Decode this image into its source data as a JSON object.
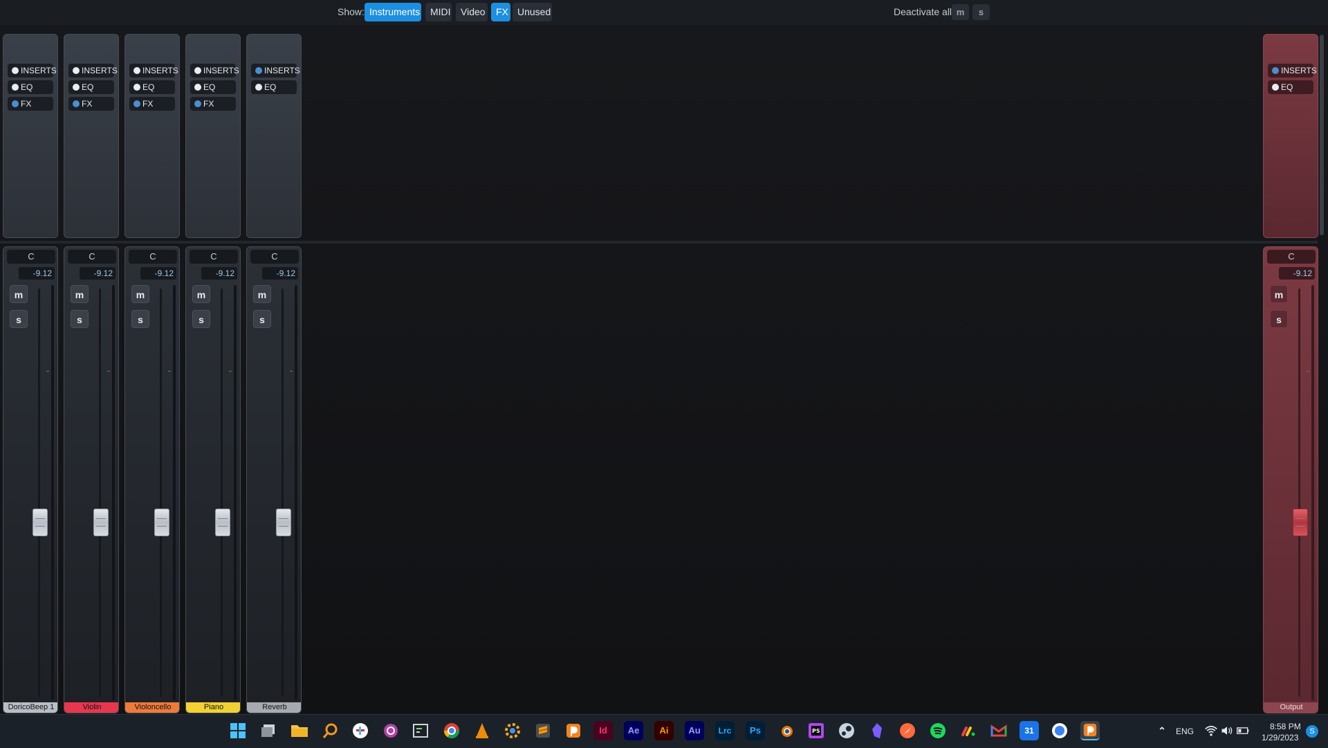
{
  "toolbar": {
    "show_label": "Show:",
    "filters": [
      {
        "label": "Instruments",
        "active": true
      },
      {
        "label": "MIDI",
        "active": false
      },
      {
        "label": "Video",
        "active": false
      },
      {
        "label": "FX",
        "active": true
      },
      {
        "label": "Unused",
        "active": false
      }
    ],
    "deactivate_label": "Deactivate all:",
    "deactivate_mute": "m",
    "deactivate_solo": "s"
  },
  "channels": [
    {
      "name": "DoricoBeep 1",
      "color": "#b9bec6",
      "pan": "C",
      "volume": "-9.12",
      "slots": [
        "INSERTS",
        "EQ",
        "FX"
      ],
      "mute": "m",
      "solo": "s"
    },
    {
      "name": "Violin",
      "color": "#e8364f",
      "pan": "C",
      "volume": "-9.12",
      "slots": [
        "INSERTS",
        "EQ",
        "FX"
      ],
      "mute": "m",
      "solo": "s"
    },
    {
      "name": "Violoncello",
      "color": "#f07a3a",
      "pan": "C",
      "volume": "-9.12",
      "slots": [
        "INSERTS",
        "EQ",
        "FX"
      ],
      "mute": "m",
      "solo": "s"
    },
    {
      "name": "Piano",
      "color": "#f2d233",
      "pan": "C",
      "volume": "-9.12",
      "slots": [
        "INSERTS",
        "EQ",
        "FX"
      ],
      "mute": "m",
      "solo": "s"
    },
    {
      "name": "Reverb",
      "color": "#a6abb2",
      "pan": "C",
      "volume": "-9.12",
      "slots": [
        "INSERTS",
        "EQ"
      ],
      "mute": "m",
      "solo": "s"
    },
    {
      "name": "Output",
      "color": "#8c4650",
      "pan": "C",
      "volume": "-9.12",
      "slots": [
        "INSERTS",
        "EQ"
      ],
      "mute": "m",
      "solo": "s"
    }
  ],
  "taskbar": {
    "apps": [
      {
        "icon": "windows-start-icon",
        "label": ""
      },
      {
        "icon": "task-view-icon",
        "label": ""
      },
      {
        "icon": "file-explorer-icon",
        "label": ""
      },
      {
        "icon": "search-icon",
        "label": ""
      },
      {
        "icon": "slack-icon",
        "label": ""
      },
      {
        "icon": "record-icon",
        "label": ""
      },
      {
        "icon": "terminal-icon",
        "label": ""
      },
      {
        "icon": "chrome-icon",
        "label": ""
      },
      {
        "icon": "vlc-icon",
        "label": ""
      },
      {
        "icon": "gear-app-icon",
        "label": ""
      },
      {
        "icon": "sublime-icon",
        "label": ""
      },
      {
        "icon": "dorico-icon",
        "label": ""
      },
      {
        "icon": "indesign-icon",
        "label": "Id"
      },
      {
        "icon": "after-effects-icon",
        "label": "Ae"
      },
      {
        "icon": "illustrator-icon",
        "label": "Ai"
      },
      {
        "icon": "audition-icon",
        "label": "Au"
      },
      {
        "icon": "lightroom-icon",
        "label": "Lrc"
      },
      {
        "icon": "photoshop-icon",
        "label": "Ps"
      },
      {
        "icon": "blender-icon",
        "label": ""
      },
      {
        "icon": "phpstorm-icon",
        "label": ""
      },
      {
        "icon": "steam-icon",
        "label": ""
      },
      {
        "icon": "obsidian-icon",
        "label": ""
      },
      {
        "icon": "compass-icon",
        "label": ""
      },
      {
        "icon": "spotify-icon",
        "label": ""
      },
      {
        "icon": "monday-icon",
        "label": ""
      },
      {
        "icon": "gmail-icon",
        "label": ""
      },
      {
        "icon": "calendar-icon",
        "label": "31"
      },
      {
        "icon": "browser-icon",
        "label": ""
      },
      {
        "icon": "dorico-active-icon",
        "label": ""
      }
    ],
    "tray": {
      "language": "ENG",
      "time": "8:58 PM",
      "date": "1/29/2023"
    }
  }
}
